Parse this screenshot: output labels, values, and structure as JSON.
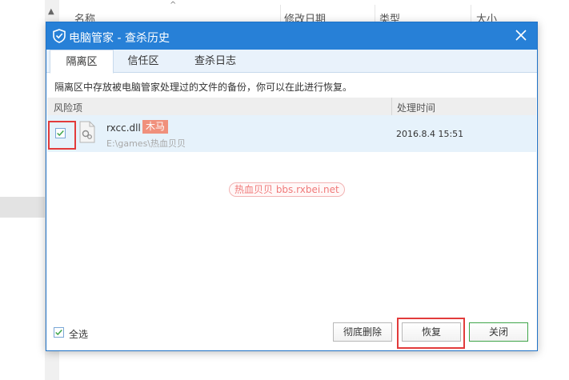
{
  "background": {
    "columns": [
      "名称",
      "修改日期",
      "类型",
      "大小"
    ]
  },
  "dialog": {
    "title": "电脑管家 - 查杀历史",
    "tabs": [
      {
        "label": "隔离区",
        "active": true
      },
      {
        "label": "信任区",
        "active": false
      },
      {
        "label": "查杀日志",
        "active": false
      }
    ],
    "description": "隔离区中存放被电脑管家处理过的文件的备份，你可以在此进行恢复。",
    "list_header": {
      "risk": "风险项",
      "time": "处理时间"
    },
    "rows": [
      {
        "name": "rxcc.dll",
        "badge": "木马",
        "path": "E:\\games\\热血贝贝",
        "time": "2016.8.4 15:51",
        "checked": true
      }
    ],
    "watermark": "热血贝贝 bbs.rxbei.net",
    "select_all": {
      "label": "全选",
      "checked": true
    },
    "buttons": {
      "delete": "彻底删除",
      "restore": "恢复",
      "close": "关闭"
    }
  },
  "colors": {
    "titlebar": "#2780d7",
    "badge": "#f0907c",
    "highlight": "#e23b3b",
    "check": "#3fa54a"
  }
}
